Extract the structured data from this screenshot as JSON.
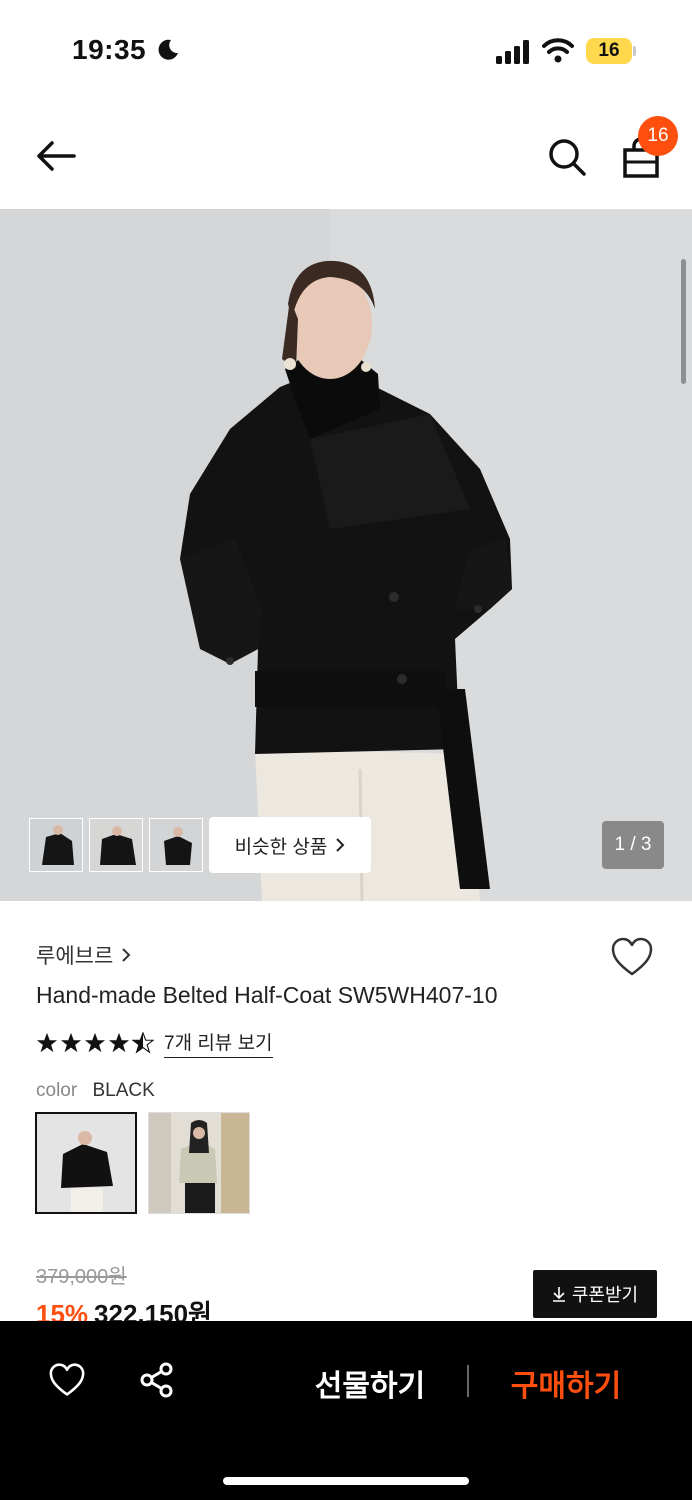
{
  "status_bar": {
    "time": "19:35",
    "battery": "16"
  },
  "header": {
    "cart_count": "16"
  },
  "hero": {
    "similar_label": "비슷한 상품",
    "page_indicator": "1 / 3"
  },
  "product": {
    "brand": "루에브르",
    "name": "Hand-made Belted Half-Coat SW5WH407-10",
    "rating": 4.5,
    "review_link": "7개 리뷰 보기",
    "color_label": "color",
    "color_value": "BLACK",
    "original_price": "379,000원",
    "discount_rate": "15%",
    "sale_price": "322,150원",
    "coupon_label": "쿠폰받기"
  },
  "bottom_bar": {
    "gift_label": "선물하기",
    "buy_label": "구매하기"
  },
  "colors": {
    "accent": "#ff4f0f",
    "black": "#000000"
  }
}
